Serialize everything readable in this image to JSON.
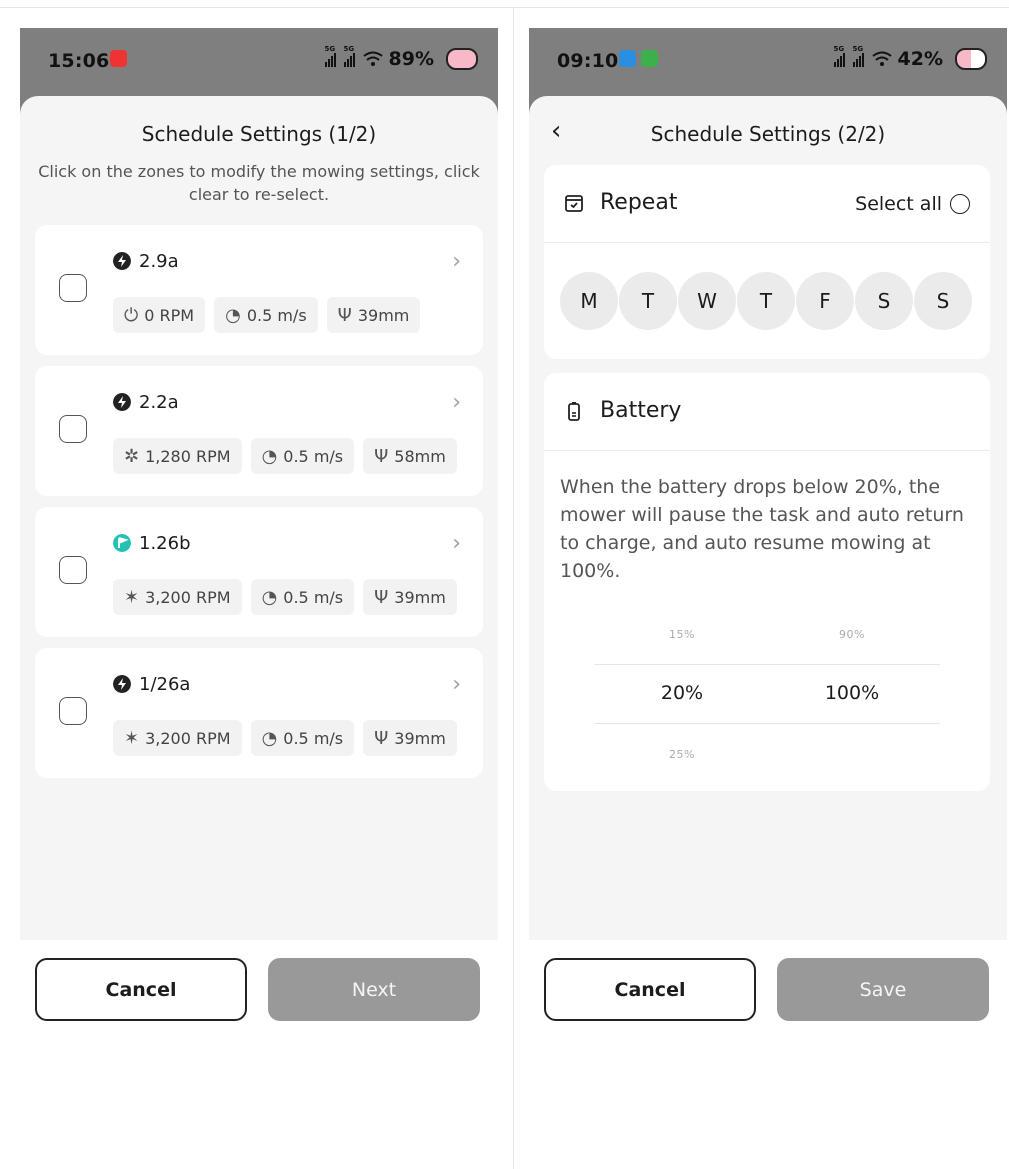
{
  "screen1": {
    "status": {
      "time": "15:06",
      "battery": "89%",
      "network": "5G"
    },
    "title": "Schedule Settings (1/2)",
    "subtitle": "Click on the zones to modify the mowing settings, click clear to re-select.",
    "zones": [
      {
        "name": "2.9a",
        "icon": "lightning-icon",
        "icon_color": "#222222",
        "rpm_icon": "power-icon",
        "rpm": "0 RPM",
        "speed": "0.5 m/s",
        "height": "39mm"
      },
      {
        "name": "2.2a",
        "icon": "lightning-icon",
        "icon_color": "#222222",
        "rpm_icon": "fan-icon",
        "rpm": "1,280 RPM",
        "speed": "0.5 m/s",
        "height": "58mm"
      },
      {
        "name": "1.26b",
        "icon": "flag-icon",
        "icon_color": "#22c1b4",
        "rpm_icon": "star-blade-icon",
        "rpm": "3,200 RPM",
        "speed": "0.5 m/s",
        "height": "39mm"
      },
      {
        "name": "1/26a",
        "icon": "lightning-icon",
        "icon_color": "#222222",
        "rpm_icon": "star-blade-icon",
        "rpm": "3,200 RPM",
        "speed": "0.5 m/s",
        "height": "39mm"
      }
    ],
    "cancel_label": "Cancel",
    "next_label": "Next"
  },
  "screen2": {
    "status": {
      "time": "09:10",
      "battery": "42%",
      "network": "5G"
    },
    "title": "Schedule Settings (2/2)",
    "repeat": {
      "title": "Repeat",
      "select_all": "Select all",
      "days": [
        "M",
        "T",
        "W",
        "T",
        "F",
        "S",
        "S"
      ]
    },
    "battery": {
      "title": "Battery",
      "description": "When the battery drops below 20%, the mower will pause the task and auto return to charge, and auto resume mowing at 100%.",
      "low_above": "15%",
      "low_selected": "20%",
      "low_below": "25%",
      "high_above": "90%",
      "high_selected": "100%"
    },
    "cancel_label": "Cancel",
    "save_label": "Save"
  },
  "colors": {
    "accent_teal": "#22c1b4",
    "disabled_button": "#999999",
    "status_bar": "#7f7f7f"
  }
}
